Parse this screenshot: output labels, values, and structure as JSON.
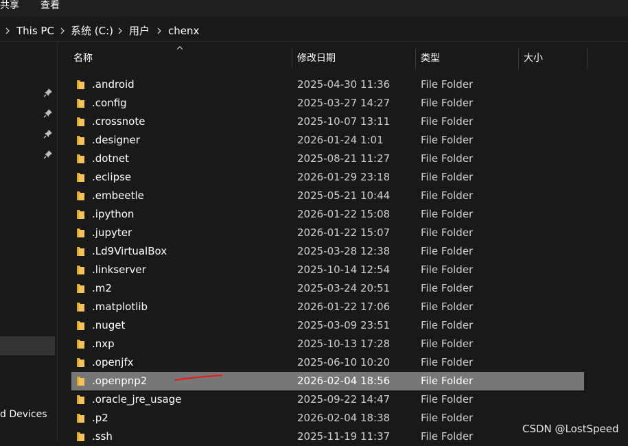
{
  "ribbon": {
    "tab_share": "共享",
    "tab_view": "查看"
  },
  "breadcrumb": {
    "items": [
      "This PC",
      "系统 (C:)",
      "用户",
      "chenx"
    ]
  },
  "nav_pane": {
    "devices_label": "d Devices"
  },
  "columns": {
    "name": "名称",
    "modified": "修改日期",
    "type": "类型",
    "size": "大小"
  },
  "colors": {
    "folder": "#f2c55c",
    "selected_row": "#777777",
    "annotation": "#e0201a"
  },
  "files": [
    {
      "name": ".android",
      "modified": "2025-04-30 11:36",
      "type": "File Folder"
    },
    {
      "name": ".config",
      "modified": "2025-03-27 14:27",
      "type": "File Folder"
    },
    {
      "name": ".crossnote",
      "modified": "2025-10-07 13:11",
      "type": "File Folder"
    },
    {
      "name": ".designer",
      "modified": "2026-01-24 1:01",
      "type": "File Folder"
    },
    {
      "name": ".dotnet",
      "modified": "2025-08-21 11:27",
      "type": "File Folder"
    },
    {
      "name": ".eclipse",
      "modified": "2026-01-29 23:18",
      "type": "File Folder"
    },
    {
      "name": ".embeetle",
      "modified": "2025-05-21 10:44",
      "type": "File Folder"
    },
    {
      "name": ".ipython",
      "modified": "2026-01-22 15:08",
      "type": "File Folder"
    },
    {
      "name": ".jupyter",
      "modified": "2026-01-22 15:07",
      "type": "File Folder"
    },
    {
      "name": ".Ld9VirtualBox",
      "modified": "2025-03-28 12:38",
      "type": "File Folder"
    },
    {
      "name": ".linkserver",
      "modified": "2025-10-14 12:54",
      "type": "File Folder"
    },
    {
      "name": ".m2",
      "modified": "2025-03-24 20:51",
      "type": "File Folder"
    },
    {
      "name": ".matplotlib",
      "modified": "2026-01-22 17:06",
      "type": "File Folder"
    },
    {
      "name": ".nuget",
      "modified": "2025-03-09 23:51",
      "type": "File Folder"
    },
    {
      "name": ".nxp",
      "modified": "2025-10-13 17:28",
      "type": "File Folder"
    },
    {
      "name": ".openjfx",
      "modified": "2025-06-10 10:20",
      "type": "File Folder"
    },
    {
      "name": ".openpnp2",
      "modified": "2026-02-04 18:56",
      "type": "File Folder",
      "selected": true
    },
    {
      "name": ".oracle_jre_usage",
      "modified": "2025-09-22 14:47",
      "type": "File Folder"
    },
    {
      "name": ".p2",
      "modified": "2026-02-04 18:38",
      "type": "File Folder"
    },
    {
      "name": ".ssh",
      "modified": "2025-11-19 11:37",
      "type": "File Folder"
    }
  ],
  "watermark": "CSDN @LostSpeed"
}
